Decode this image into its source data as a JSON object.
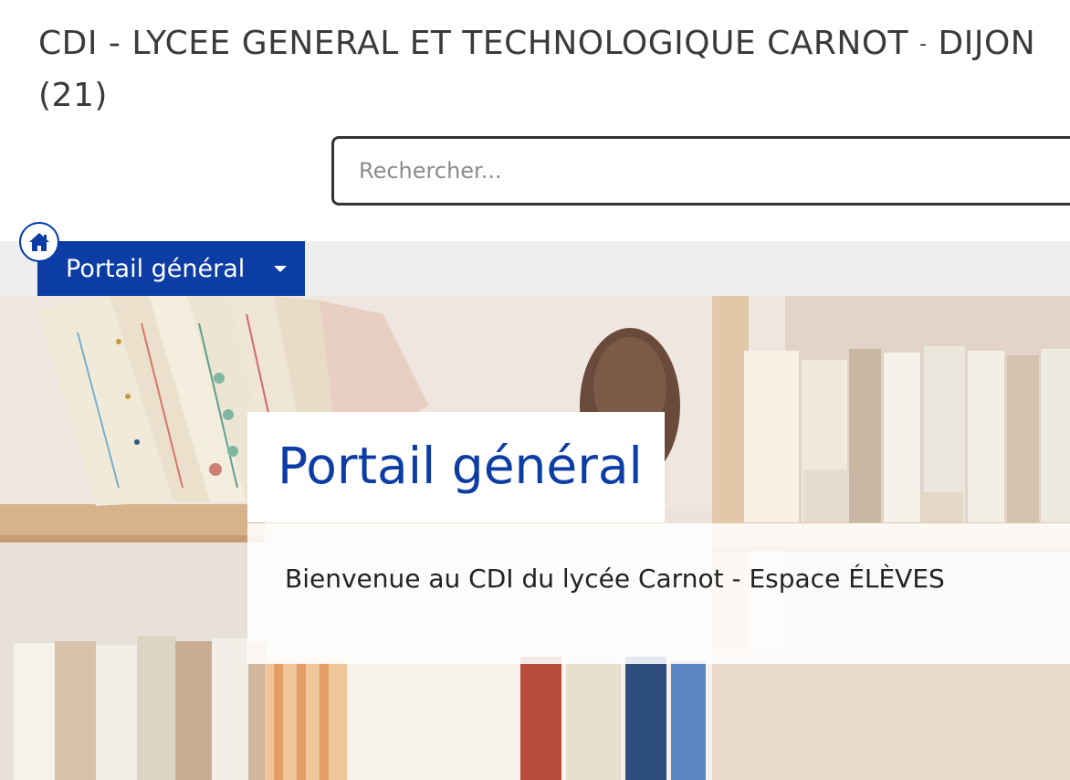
{
  "header": {
    "title_main": "CDI - LYCEE GENERAL ET TECHNOLOGIQUE CARNOT",
    "title_sep": "-",
    "title_end": "DIJON (21)"
  },
  "search": {
    "placeholder": "Rechercher..."
  },
  "nav": {
    "home_icon": "home-icon",
    "portal_label": "Portail général",
    "portal_icon": "caret-down-icon"
  },
  "hero": {
    "title": "Portail général",
    "text": "Bienvenue au CDI du lycée Carnot - Espace ÉLÈVES"
  },
  "colors": {
    "brand_blue": "#0c3da5",
    "nav_bg": "#eeeeee",
    "title_text": "#3a3a3a"
  }
}
